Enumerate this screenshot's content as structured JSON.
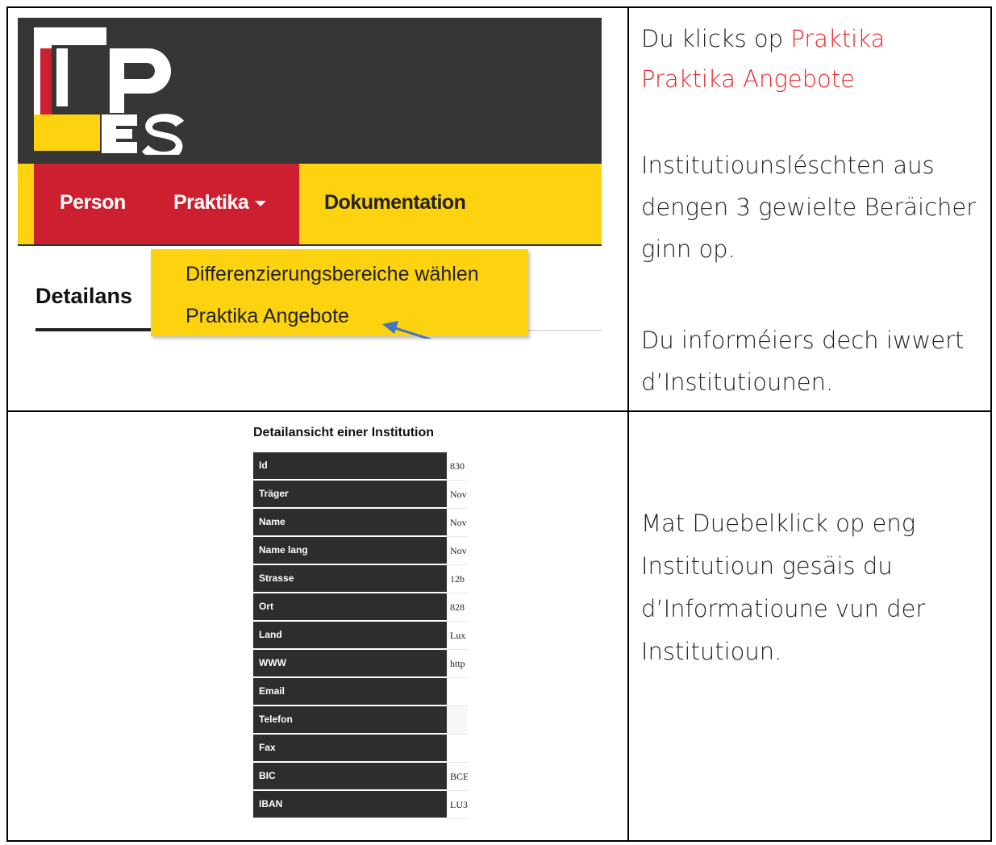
{
  "screenshot_nav": {
    "items": [
      "Person",
      "Praktika",
      "Dokumentation"
    ],
    "detail_tab": "Detailans",
    "dropdown": [
      "Differenzierungsbereiche wählen",
      "Praktika Angebote"
    ]
  },
  "right_top": {
    "line1_prefix": "Du klicks op ",
    "line1_link": "Praktika",
    "line2_link": "Praktika Angebote",
    "para2": [
      "Institutiounsléschten aus",
      "dengen 3 gewielte Beräicher",
      "ginn op."
    ],
    "para3": [
      "Du informéiers dech iwwert",
      "d’Institutiounen."
    ]
  },
  "detail": {
    "title": "Detailansicht einer Institution",
    "rows": [
      {
        "label": "Id",
        "value": "830"
      },
      {
        "label": "Träger",
        "value": "Nov"
      },
      {
        "label": "Name",
        "value": "Nov"
      },
      {
        "label": "Name lang",
        "value": "Nov"
      },
      {
        "label": "Strasse",
        "value": "12b"
      },
      {
        "label": "Ort",
        "value": "828"
      },
      {
        "label": "Land",
        "value": "Lux"
      },
      {
        "label": "WWW",
        "value": "http"
      },
      {
        "label": "Email",
        "value": ""
      },
      {
        "label": "Telefon",
        "value": ""
      },
      {
        "label": "Fax",
        "value": ""
      },
      {
        "label": "BIC",
        "value": "BCE"
      },
      {
        "label": "IBAN",
        "value": "LU3"
      }
    ]
  },
  "right_bottom": {
    "lines": [
      "Mat Duebelklick op eng",
      "Institutioun gesäis du",
      "d’Informatioune vun der",
      "Institutioun."
    ]
  },
  "colors": {
    "header_dark": "#363636",
    "nav_yellow": "#fdd20e",
    "nav_red": "#cc1f2f",
    "link_red": "#e8262b",
    "arrow_blue": "#4472c4"
  }
}
